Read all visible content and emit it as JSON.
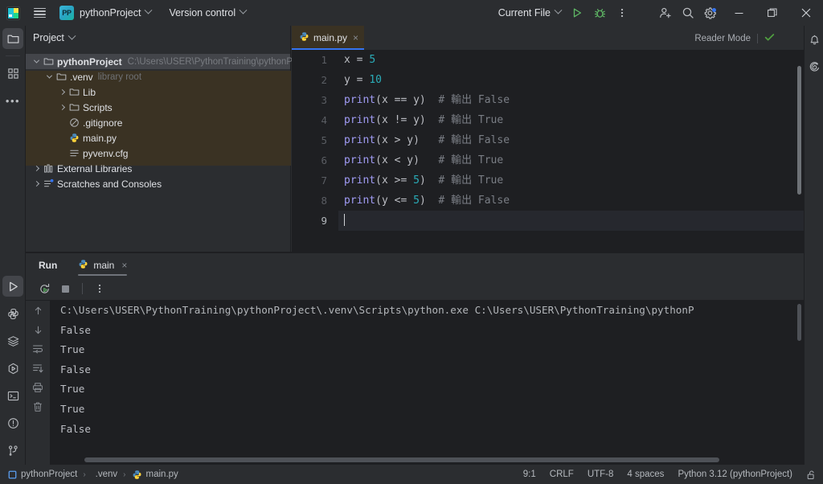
{
  "titlebar": {
    "app_icon": "pycharm-logo-icon",
    "menu_icon": "hamburger-menu-icon",
    "project_badge": "PP",
    "project_name": "pythonProject",
    "vcs_label": "Version control",
    "run_config": "Current File",
    "run_icon": "run-play-icon",
    "debug_icon": "debug-bug-icon",
    "more_icon": "more-vertical-icon",
    "account_icon": "add-account-icon",
    "search_icon": "search-icon",
    "settings_icon": "gear-icon",
    "minimize_icon": "minimize-icon",
    "maximize_icon": "maximize-icon",
    "close_icon": "close-icon"
  },
  "left_rail": {
    "top": [
      {
        "name": "project-tool-window",
        "icon": "folder-icon",
        "selected": true
      },
      {
        "name": "structure-tool-window",
        "icon": "structure-grid-icon",
        "selected": false
      },
      {
        "name": "more-tool-windows",
        "icon": "ellipsis-icon",
        "selected": false
      }
    ],
    "bottom": [
      {
        "name": "run-tool-window",
        "icon": "run-play-icon",
        "selected": true
      },
      {
        "name": "python-console-tool-window",
        "icon": "python-icon",
        "selected": false
      },
      {
        "name": "services-tool-window",
        "icon": "layers-icon",
        "selected": false
      },
      {
        "name": "python-packages-tool-window",
        "icon": "package-play-icon",
        "selected": false
      },
      {
        "name": "terminal-tool-window",
        "icon": "terminal-icon",
        "selected": false
      },
      {
        "name": "problems-tool-window",
        "icon": "warning-circle-icon",
        "selected": false
      },
      {
        "name": "git-tool-window",
        "icon": "git-branch-icon",
        "selected": false
      }
    ]
  },
  "project_panel": {
    "header": "Project",
    "tree": [
      {
        "label": "pythonProject",
        "sub": "C:\\Users\\USER\\PythonTraining\\pythonProject",
        "icon": "folder-icon",
        "arrow": "down",
        "depth": 0,
        "bold": true,
        "selected": true
      },
      {
        "label": ".venv",
        "sub": "library root",
        "icon": "folder-icon",
        "arrow": "down",
        "depth": 1,
        "bold": false,
        "selected": false
      },
      {
        "label": "Lib",
        "sub": "",
        "icon": "folder-icon",
        "arrow": "right",
        "depth": 2,
        "bold": false,
        "selected": false
      },
      {
        "label": "Scripts",
        "sub": "",
        "icon": "folder-icon",
        "arrow": "right",
        "depth": 2,
        "bold": false,
        "selected": false
      },
      {
        "label": ".gitignore",
        "sub": "",
        "icon": "gitignore-icon",
        "arrow": "none",
        "depth": 2,
        "bold": false,
        "selected": false
      },
      {
        "label": "main.py",
        "sub": "",
        "icon": "python-icon",
        "arrow": "none",
        "depth": 2,
        "bold": false,
        "selected": false
      },
      {
        "label": "pyvenv.cfg",
        "sub": "",
        "icon": "config-file-icon",
        "arrow": "none",
        "depth": 2,
        "bold": false,
        "selected": false
      },
      {
        "label": "External Libraries",
        "sub": "",
        "icon": "library-icon",
        "arrow": "right",
        "depth": 0,
        "bold": false,
        "selected": false
      },
      {
        "label": "Scratches and Consoles",
        "sub": "",
        "icon": "scratches-icon",
        "arrow": "right",
        "depth": 0,
        "bold": false,
        "selected": false
      }
    ]
  },
  "editor": {
    "tab": {
      "name": "main.py",
      "icon": "python-icon",
      "close": "×"
    },
    "reader_mode_label": "Reader Mode",
    "reader_mode_check": "check-icon",
    "lines": [
      {
        "n": "1",
        "tokens": [
          {
            "t": "x = ",
            "c": "plain"
          },
          {
            "t": "5",
            "c": "num"
          }
        ]
      },
      {
        "n": "2",
        "tokens": [
          {
            "t": "y = ",
            "c": "plain"
          },
          {
            "t": "10",
            "c": "num"
          }
        ]
      },
      {
        "n": "3",
        "tokens": [
          {
            "t": "print",
            "c": "fn"
          },
          {
            "t": "(x == y)  ",
            "c": "plain"
          },
          {
            "t": "# 輸出 False",
            "c": "cmt"
          }
        ]
      },
      {
        "n": "4",
        "tokens": [
          {
            "t": "print",
            "c": "fn"
          },
          {
            "t": "(x != y)  ",
            "c": "plain"
          },
          {
            "t": "# 輸出 True",
            "c": "cmt"
          }
        ]
      },
      {
        "n": "5",
        "tokens": [
          {
            "t": "print",
            "c": "fn"
          },
          {
            "t": "(x > y)   ",
            "c": "plain"
          },
          {
            "t": "# 輸出 False",
            "c": "cmt"
          }
        ]
      },
      {
        "n": "6",
        "tokens": [
          {
            "t": "print",
            "c": "fn"
          },
          {
            "t": "(x < y)   ",
            "c": "plain"
          },
          {
            "t": "# 輸出 True",
            "c": "cmt"
          }
        ]
      },
      {
        "n": "7",
        "tokens": [
          {
            "t": "print",
            "c": "fn"
          },
          {
            "t": "(x >= ",
            "c": "plain"
          },
          {
            "t": "5",
            "c": "num"
          },
          {
            "t": ")  ",
            "c": "plain"
          },
          {
            "t": "# 輸出 True",
            "c": "cmt"
          }
        ]
      },
      {
        "n": "8",
        "tokens": [
          {
            "t": "print",
            "c": "fn"
          },
          {
            "t": "(y <= ",
            "c": "plain"
          },
          {
            "t": "5",
            "c": "num"
          },
          {
            "t": ")  ",
            "c": "plain"
          },
          {
            "t": "# 輸出 False",
            "c": "cmt"
          }
        ]
      },
      {
        "n": "9",
        "tokens": [],
        "current": true,
        "caret": true
      }
    ]
  },
  "run_panel": {
    "title": "Run",
    "tab": {
      "name": "main",
      "icon": "python-icon",
      "close": "×"
    },
    "toolbar": [
      {
        "name": "rerun-button",
        "icon": "rerun-icon"
      },
      {
        "name": "stop-button",
        "icon": "stop-square-icon"
      },
      {
        "name": "run-more-options-button",
        "icon": "more-vertical-icon"
      }
    ],
    "console_side_toolbar": [
      {
        "name": "scroll-up-button",
        "icon": "arrow-up-icon"
      },
      {
        "name": "scroll-down-button",
        "icon": "arrow-down-icon"
      },
      {
        "name": "soft-wrap-button",
        "icon": "soft-wrap-icon"
      },
      {
        "name": "scroll-to-end-button",
        "icon": "scroll-to-end-icon"
      },
      {
        "name": "print-button",
        "icon": "printer-icon"
      },
      {
        "name": "clear-all-button",
        "icon": "trash-icon"
      }
    ],
    "output": [
      "C:\\Users\\USER\\PythonTraining\\pythonProject\\.venv\\Scripts\\python.exe C:\\Users\\USER\\PythonTraining\\pythonP",
      "False",
      "True",
      "False",
      "True",
      "True",
      "False"
    ]
  },
  "right_rail": [
    {
      "name": "notifications-button",
      "icon": "bell-icon"
    },
    {
      "name": "ai-assistant-button",
      "icon": "ai-spiral-icon"
    }
  ],
  "statusbar": {
    "breadcrumb": [
      {
        "label": "pythonProject",
        "icon": "module-icon"
      },
      {
        "label": ".venv",
        "icon": "none"
      },
      {
        "label": "main.py",
        "icon": "python-icon"
      }
    ],
    "separator": "›",
    "caret_position": "9:1",
    "line_separator": "CRLF",
    "encoding": "UTF-8",
    "indent": "4 spaces",
    "interpreter": "Python 3.12 (pythonProject)",
    "lock_icon": "unlocked-icon"
  },
  "colors": {
    "accent": "#3574f0",
    "bg_dark": "#1e1f22",
    "bg_panel": "#2b2d30",
    "venv_highlight": "#3a3223",
    "number_token": "#2aacb8",
    "function_token": "#a19cf5",
    "comment_token": "#7a7e85",
    "check_green": "#4f9e3f"
  }
}
